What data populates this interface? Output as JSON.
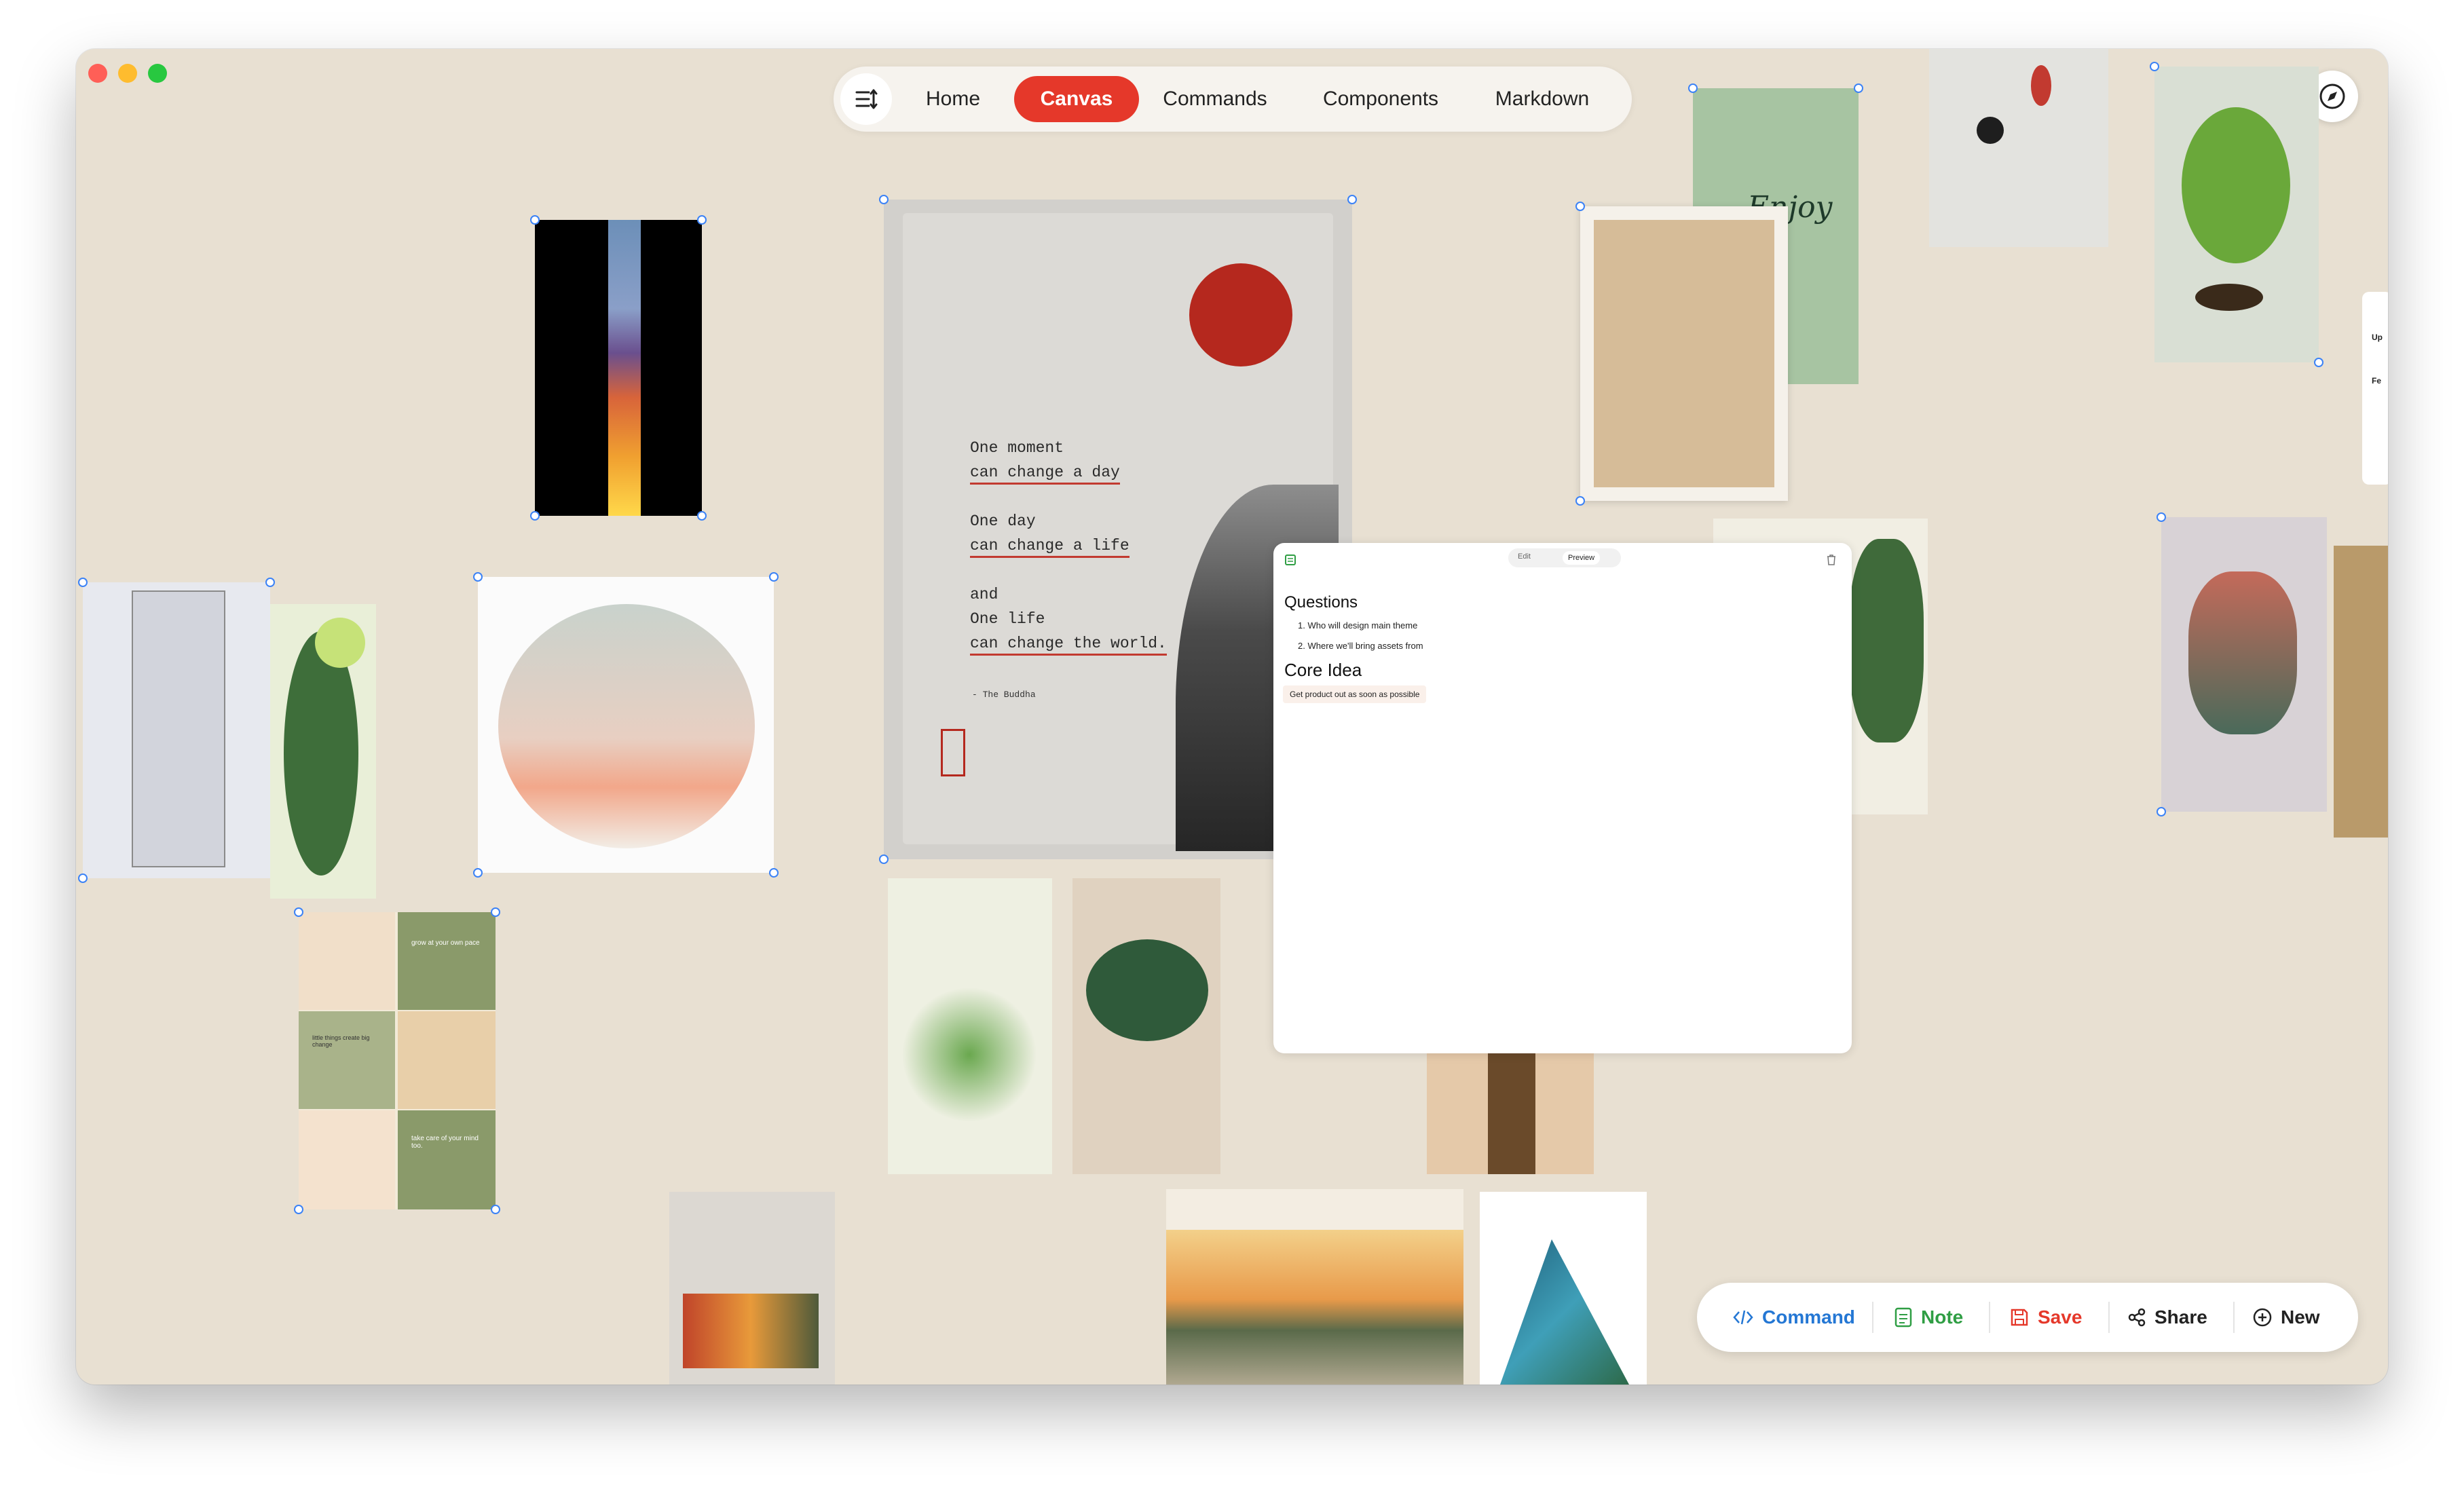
{
  "nav": {
    "tabs": [
      {
        "label": "Home",
        "active": false
      },
      {
        "label": "Canvas",
        "active": true
      },
      {
        "label": "Commands",
        "active": false
      },
      {
        "label": "Components",
        "active": false
      },
      {
        "label": "Markdown",
        "active": false
      }
    ],
    "menu_icon": "sort-lines-icon",
    "accent_color": "#e5382a"
  },
  "canvas": {
    "background_color": "#e8e0d2",
    "compass_icon": "compass-icon",
    "poster": {
      "lines": [
        "One moment",
        "can change a day",
        "One day",
        "can change a life",
        "and",
        "One life",
        "can change the world."
      ],
      "attribution": "- The Buddha"
    },
    "wellness_grid": {
      "tiles": [
        "grow at your own pace",
        "little things create big change",
        "take care of your mind too."
      ]
    },
    "green_poster_text": "Enjoy",
    "side_card": {
      "letters_1": "Up",
      "letters_2": "Fe"
    }
  },
  "note": {
    "edit_label": "Edit",
    "preview_label": "Preview",
    "heading1": "Questions",
    "items": [
      "Who will design main theme",
      "Where we'll bring assets from"
    ],
    "heading2": "Core Idea",
    "tag": "Get product out as soon as possible"
  },
  "toolbar": {
    "command": {
      "label": "Command",
      "color": "#2477d4"
    },
    "note": {
      "label": "Note",
      "color": "#2f9e44"
    },
    "save": {
      "label": "Save",
      "color": "#e5382a"
    },
    "share": {
      "label": "Share",
      "color": "#222222"
    },
    "new": {
      "label": "New",
      "color": "#222222"
    }
  }
}
